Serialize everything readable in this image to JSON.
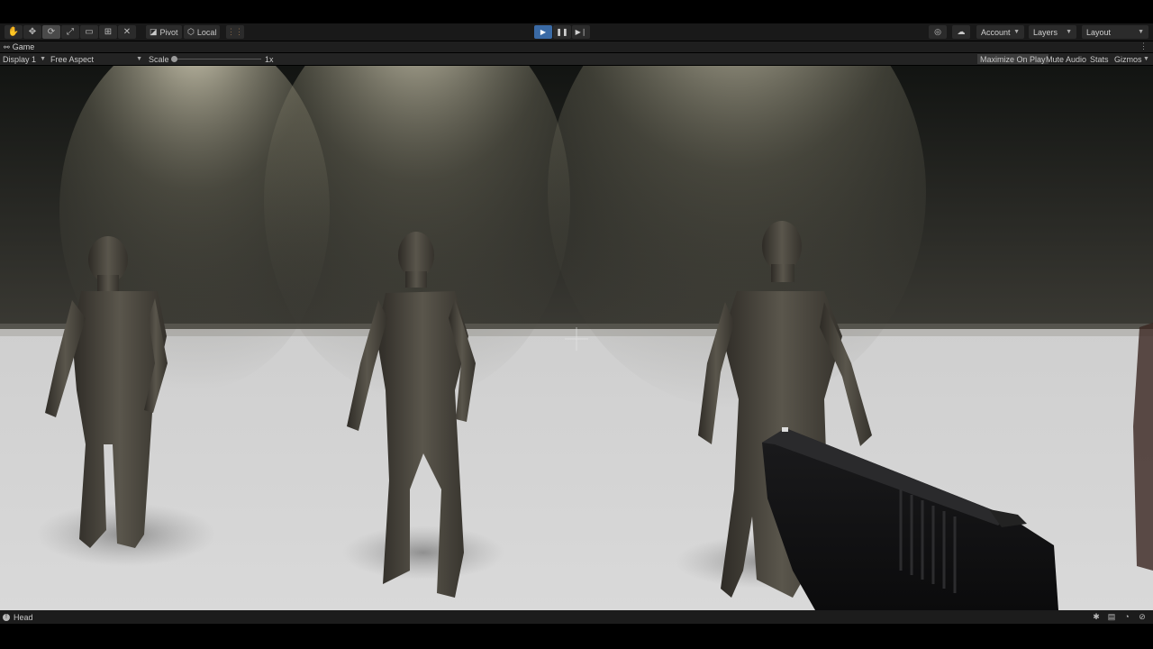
{
  "toolbar": {
    "tools": [
      {
        "name": "hand-tool-icon",
        "glyph": "✋"
      },
      {
        "name": "move-tool-icon",
        "glyph": "✥"
      },
      {
        "name": "rotate-tool-icon",
        "glyph": "⟳"
      },
      {
        "name": "scale-tool-icon",
        "glyph": "⤢"
      },
      {
        "name": "rect-tool-icon",
        "glyph": "▭"
      },
      {
        "name": "transform-tool-icon",
        "glyph": "⊞"
      },
      {
        "name": "custom-tool-icon",
        "glyph": "✕"
      }
    ],
    "pivot_label": "Pivot",
    "local_label": "Local",
    "account_label": "Account",
    "layers_label": "Layers",
    "layout_label": "Layout"
  },
  "tab": {
    "game_label": "Game"
  },
  "game_toolbar": {
    "display_value": "Display 1",
    "aspect_value": "Free Aspect",
    "scale_label": "Scale",
    "scale_value": "1x",
    "maximize_label": "Maximize On Play",
    "mute_label": "Mute Audio",
    "stats_label": "Stats",
    "gizmos_label": "Gizmos"
  },
  "status": {
    "message": "Head"
  },
  "colors": {
    "play_accent": "#3a6aa5",
    "panel_bg": "#191919"
  }
}
